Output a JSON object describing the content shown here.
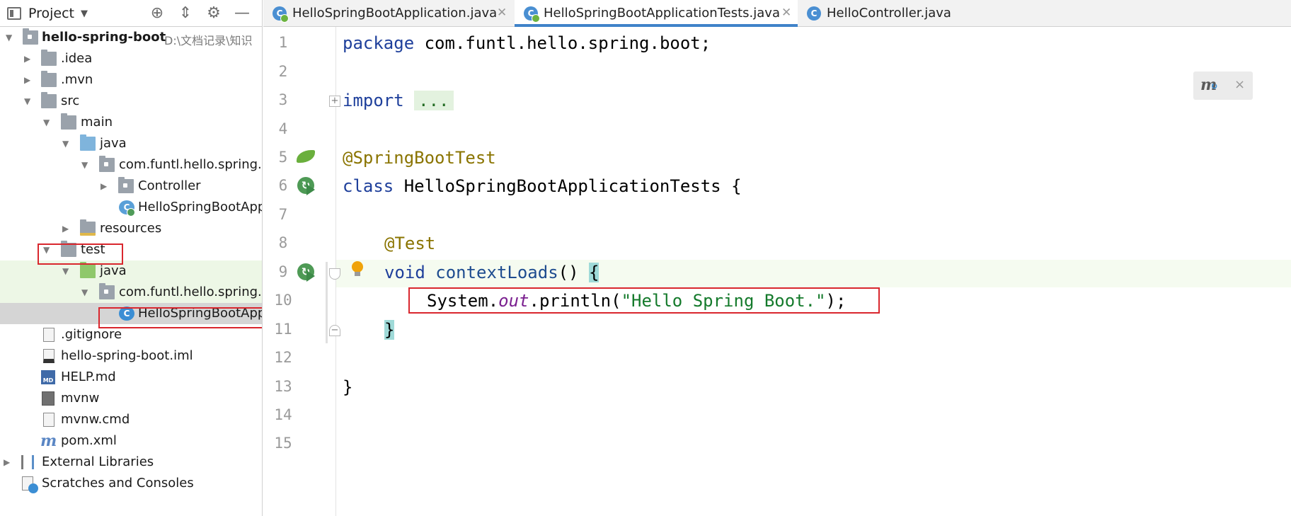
{
  "project_panel": {
    "title": "Project",
    "tools": [
      "locate-icon",
      "collapse-icon",
      "gear-icon",
      "minimize-icon"
    ],
    "tree": {
      "root_name": "hello-spring-boot",
      "root_path": "D:\\文档记录\\知识",
      "idea": ".idea",
      "mvn": ".mvn",
      "src": "src",
      "main": "main",
      "main_java": "java",
      "main_pkg": "com.funtl.hello.spring.b",
      "controller": "Controller",
      "main_app": "HelloSpringBootApp",
      "resources": "resources",
      "test": "test",
      "test_java": "java",
      "test_pkg": "com.funtl.hello.spring.b",
      "test_app": "HelloSpringBootApp",
      "gitignore": ".gitignore",
      "iml": "hello-spring-boot.iml",
      "help": "HELP.md",
      "mvnw": "mvnw",
      "mvnw_cmd": "mvnw.cmd",
      "pom": "pom.xml",
      "external_libraries": "External Libraries",
      "scratches": "Scratches and Consoles"
    },
    "icon_letters": {
      "md": "MD",
      "maven": "m",
      "class": "C"
    }
  },
  "tabs": [
    {
      "label": "HelloSpringBootApplication.java",
      "active": false
    },
    {
      "label": "HelloSpringBootApplicationTests.java",
      "active": true
    },
    {
      "label": "HelloController.java",
      "active": false
    }
  ],
  "editor": {
    "line_numbers": [
      "1",
      "2",
      "3",
      "4",
      "5",
      "6",
      "7",
      "8",
      "9",
      "10",
      "11",
      "12",
      "13",
      "14",
      "15"
    ],
    "code": {
      "l1_kw": "package",
      "l1_rest": " com.funtl.hello.spring.boot;",
      "l3_kw": "import",
      "l3_dots": "...",
      "l6_ann": "@SpringBootTest",
      "l7_kw": "class",
      "l7_rest": " HelloSpringBootApplicationTests {",
      "l9_ann": "@Test",
      "l10_kw": "void",
      "l10_mth": "contextLoads",
      "l10_paren": "() ",
      "l10_brace": "{",
      "l11_a": "System.",
      "l11_out": "out",
      "l11_b": ".println(",
      "l11_str": "\"Hello Spring Boot.\"",
      "l11_c": ");",
      "l12_brace": "}",
      "l14": "}"
    }
  },
  "maven_popup": {
    "icon": "m",
    "close": "×"
  }
}
